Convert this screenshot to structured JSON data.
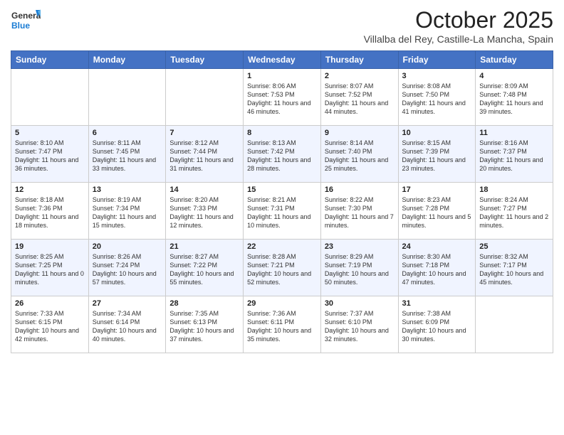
{
  "header": {
    "logo_general": "General",
    "logo_blue": "Blue",
    "month_year": "October 2025",
    "location": "Villalba del Rey, Castille-La Mancha, Spain"
  },
  "days_of_week": [
    "Sunday",
    "Monday",
    "Tuesday",
    "Wednesday",
    "Thursday",
    "Friday",
    "Saturday"
  ],
  "weeks": [
    [
      {
        "day": "",
        "info": ""
      },
      {
        "day": "",
        "info": ""
      },
      {
        "day": "",
        "info": ""
      },
      {
        "day": "1",
        "info": "Sunrise: 8:06 AM\nSunset: 7:53 PM\nDaylight: 11 hours and 46 minutes."
      },
      {
        "day": "2",
        "info": "Sunrise: 8:07 AM\nSunset: 7:52 PM\nDaylight: 11 hours and 44 minutes."
      },
      {
        "day": "3",
        "info": "Sunrise: 8:08 AM\nSunset: 7:50 PM\nDaylight: 11 hours and 41 minutes."
      },
      {
        "day": "4",
        "info": "Sunrise: 8:09 AM\nSunset: 7:48 PM\nDaylight: 11 hours and 39 minutes."
      }
    ],
    [
      {
        "day": "5",
        "info": "Sunrise: 8:10 AM\nSunset: 7:47 PM\nDaylight: 11 hours and 36 minutes."
      },
      {
        "day": "6",
        "info": "Sunrise: 8:11 AM\nSunset: 7:45 PM\nDaylight: 11 hours and 33 minutes."
      },
      {
        "day": "7",
        "info": "Sunrise: 8:12 AM\nSunset: 7:44 PM\nDaylight: 11 hours and 31 minutes."
      },
      {
        "day": "8",
        "info": "Sunrise: 8:13 AM\nSunset: 7:42 PM\nDaylight: 11 hours and 28 minutes."
      },
      {
        "day": "9",
        "info": "Sunrise: 8:14 AM\nSunset: 7:40 PM\nDaylight: 11 hours and 25 minutes."
      },
      {
        "day": "10",
        "info": "Sunrise: 8:15 AM\nSunset: 7:39 PM\nDaylight: 11 hours and 23 minutes."
      },
      {
        "day": "11",
        "info": "Sunrise: 8:16 AM\nSunset: 7:37 PM\nDaylight: 11 hours and 20 minutes."
      }
    ],
    [
      {
        "day": "12",
        "info": "Sunrise: 8:18 AM\nSunset: 7:36 PM\nDaylight: 11 hours and 18 minutes."
      },
      {
        "day": "13",
        "info": "Sunrise: 8:19 AM\nSunset: 7:34 PM\nDaylight: 11 hours and 15 minutes."
      },
      {
        "day": "14",
        "info": "Sunrise: 8:20 AM\nSunset: 7:33 PM\nDaylight: 11 hours and 12 minutes."
      },
      {
        "day": "15",
        "info": "Sunrise: 8:21 AM\nSunset: 7:31 PM\nDaylight: 11 hours and 10 minutes."
      },
      {
        "day": "16",
        "info": "Sunrise: 8:22 AM\nSunset: 7:30 PM\nDaylight: 11 hours and 7 minutes."
      },
      {
        "day": "17",
        "info": "Sunrise: 8:23 AM\nSunset: 7:28 PM\nDaylight: 11 hours and 5 minutes."
      },
      {
        "day": "18",
        "info": "Sunrise: 8:24 AM\nSunset: 7:27 PM\nDaylight: 11 hours and 2 minutes."
      }
    ],
    [
      {
        "day": "19",
        "info": "Sunrise: 8:25 AM\nSunset: 7:25 PM\nDaylight: 11 hours and 0 minutes."
      },
      {
        "day": "20",
        "info": "Sunrise: 8:26 AM\nSunset: 7:24 PM\nDaylight: 10 hours and 57 minutes."
      },
      {
        "day": "21",
        "info": "Sunrise: 8:27 AM\nSunset: 7:22 PM\nDaylight: 10 hours and 55 minutes."
      },
      {
        "day": "22",
        "info": "Sunrise: 8:28 AM\nSunset: 7:21 PM\nDaylight: 10 hours and 52 minutes."
      },
      {
        "day": "23",
        "info": "Sunrise: 8:29 AM\nSunset: 7:19 PM\nDaylight: 10 hours and 50 minutes."
      },
      {
        "day": "24",
        "info": "Sunrise: 8:30 AM\nSunset: 7:18 PM\nDaylight: 10 hours and 47 minutes."
      },
      {
        "day": "25",
        "info": "Sunrise: 8:32 AM\nSunset: 7:17 PM\nDaylight: 10 hours and 45 minutes."
      }
    ],
    [
      {
        "day": "26",
        "info": "Sunrise: 7:33 AM\nSunset: 6:15 PM\nDaylight: 10 hours and 42 minutes."
      },
      {
        "day": "27",
        "info": "Sunrise: 7:34 AM\nSunset: 6:14 PM\nDaylight: 10 hours and 40 minutes."
      },
      {
        "day": "28",
        "info": "Sunrise: 7:35 AM\nSunset: 6:13 PM\nDaylight: 10 hours and 37 minutes."
      },
      {
        "day": "29",
        "info": "Sunrise: 7:36 AM\nSunset: 6:11 PM\nDaylight: 10 hours and 35 minutes."
      },
      {
        "day": "30",
        "info": "Sunrise: 7:37 AM\nSunset: 6:10 PM\nDaylight: 10 hours and 32 minutes."
      },
      {
        "day": "31",
        "info": "Sunrise: 7:38 AM\nSunset: 6:09 PM\nDaylight: 10 hours and 30 minutes."
      },
      {
        "day": "",
        "info": ""
      }
    ]
  ]
}
